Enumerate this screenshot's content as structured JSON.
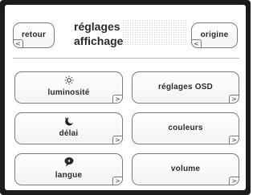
{
  "header": {
    "back_label": "retour",
    "title_line1": "réglages",
    "title_line2": "affichage",
    "origin_label": "origine",
    "back_arrow": "<",
    "origin_arrow": "<"
  },
  "menu": [
    {
      "label": "luminosité",
      "icon": "sun-icon",
      "arrow": ">"
    },
    {
      "label": "réglages OSD",
      "icon": "",
      "arrow": ">"
    },
    {
      "label": "délai",
      "icon": "moon-icon",
      "arrow": ">"
    },
    {
      "label": "couleurs",
      "icon": "",
      "arrow": ">"
    },
    {
      "label": "langue",
      "icon": "speech-bubble-icon",
      "arrow": ">"
    },
    {
      "label": "volume",
      "icon": "",
      "arrow": ">"
    }
  ]
}
